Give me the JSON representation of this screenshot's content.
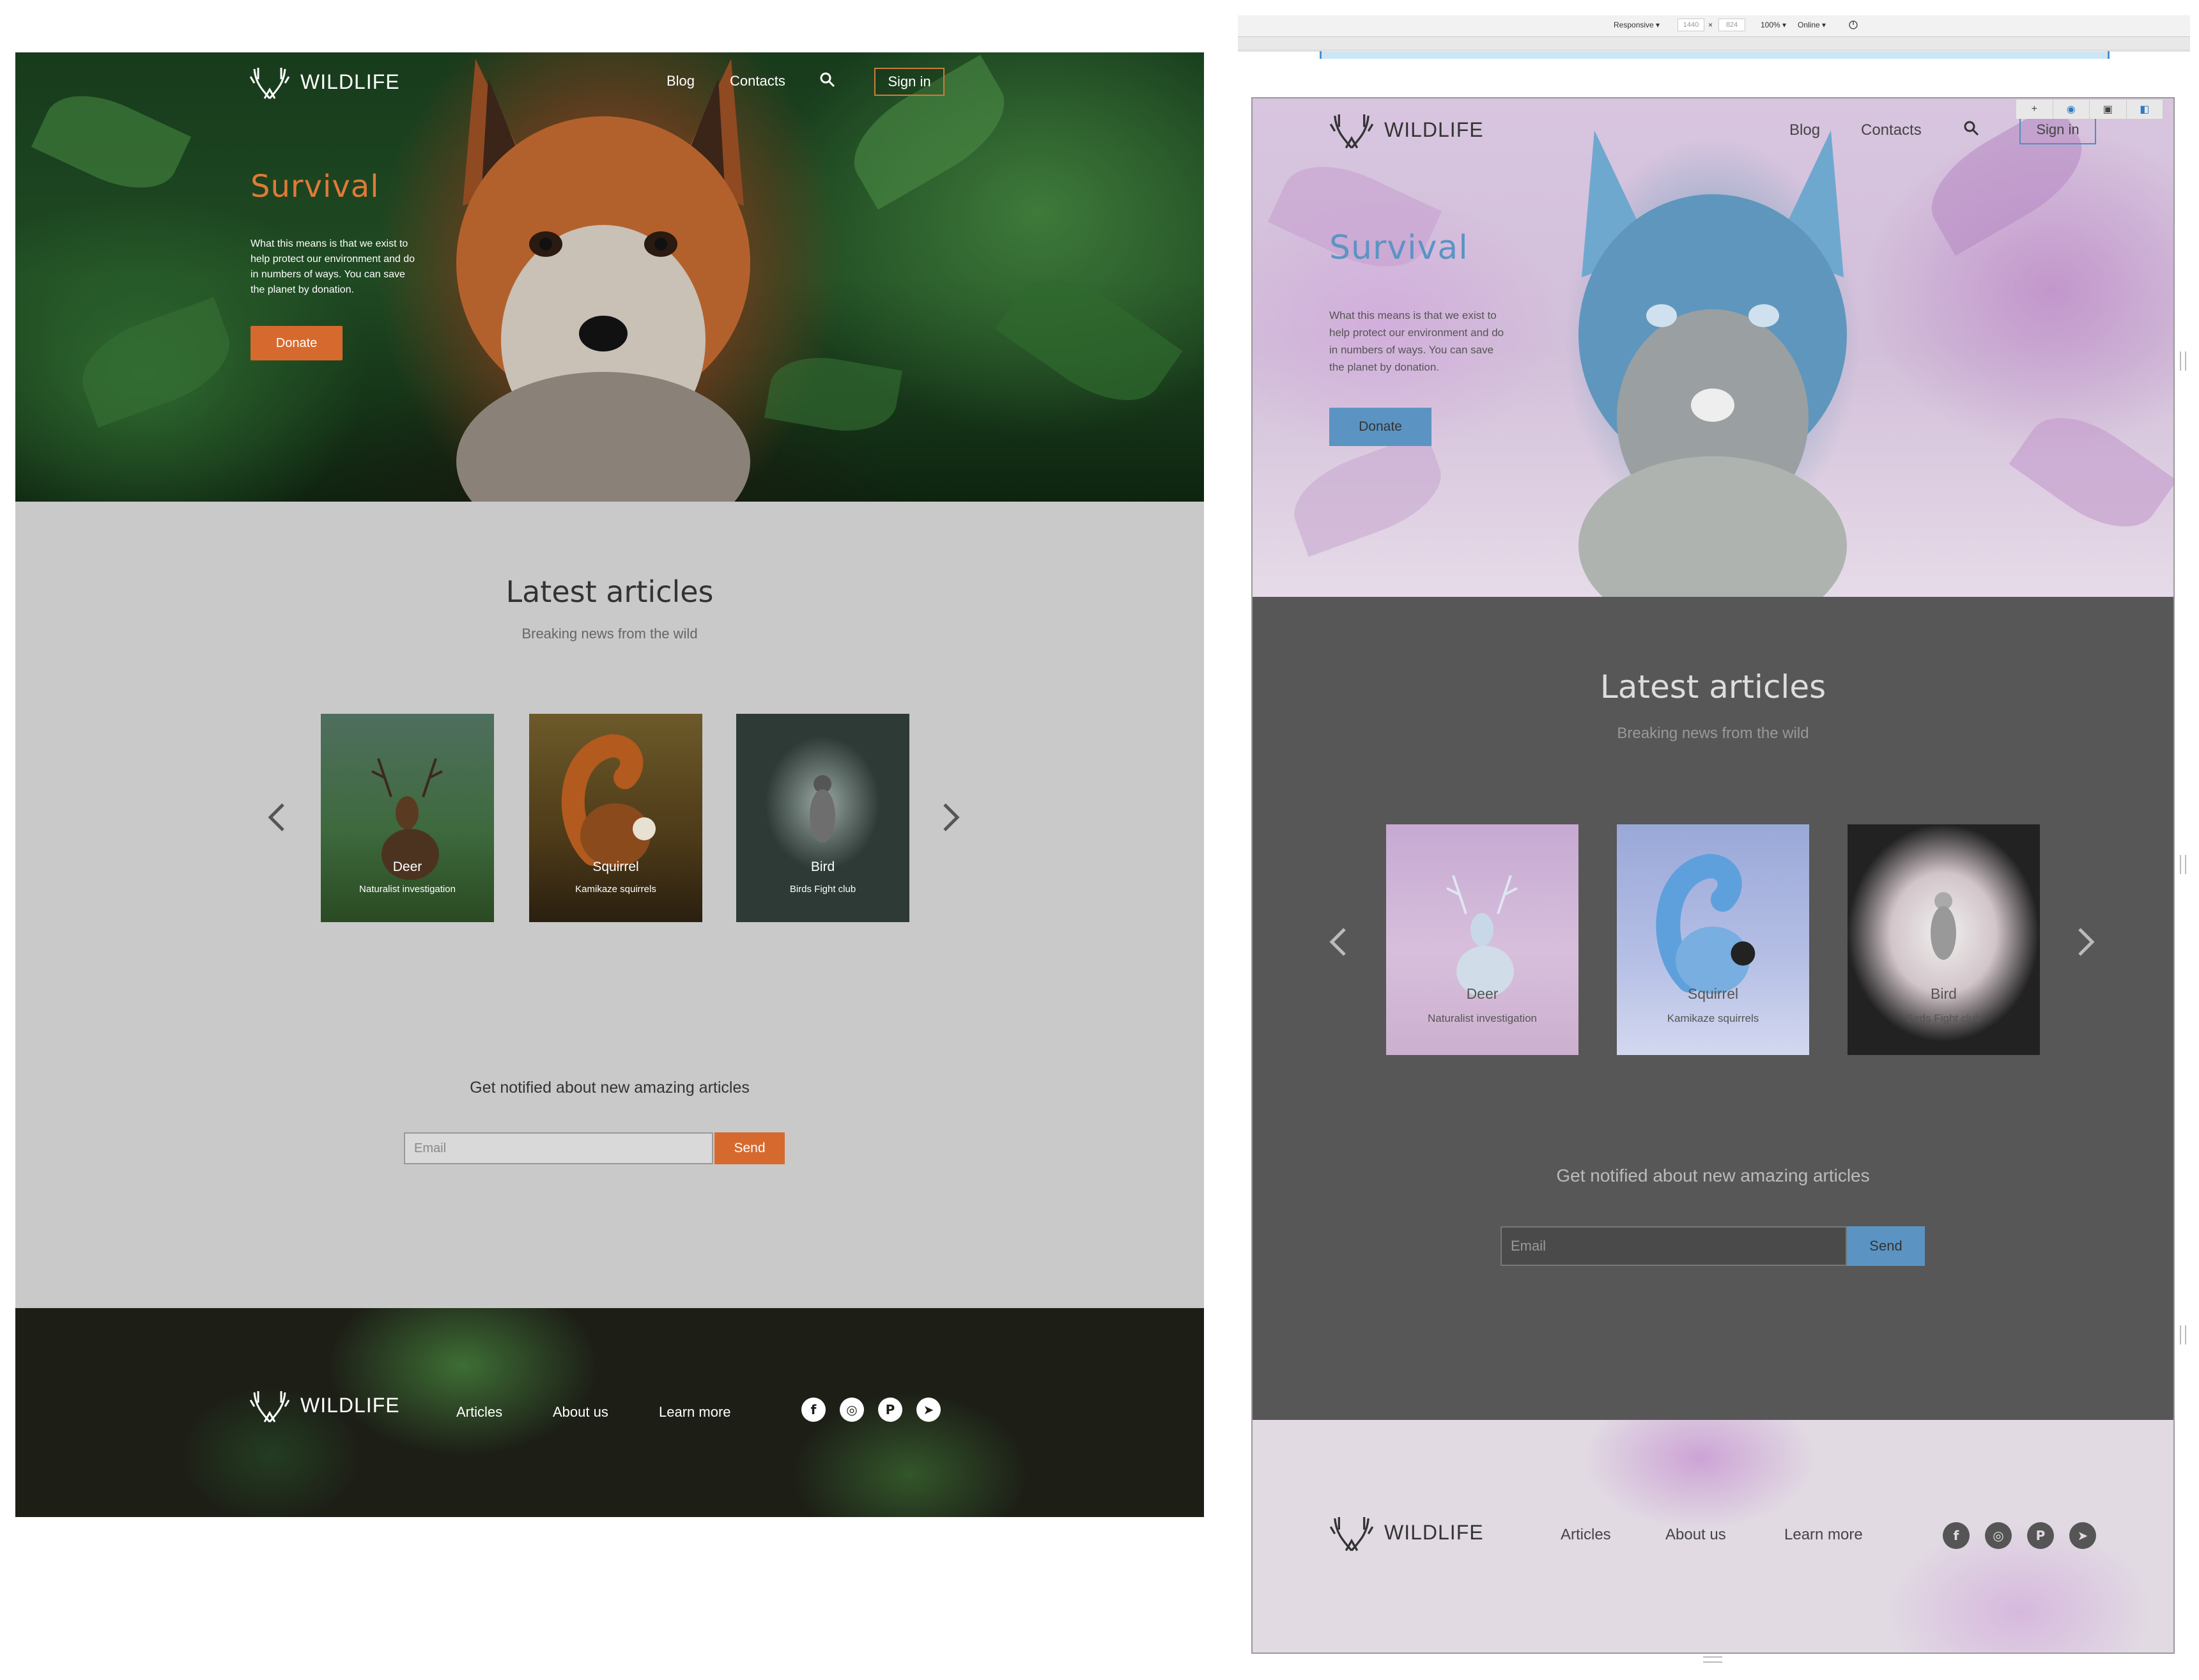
{
  "brand": {
    "name": "WILDLIFE"
  },
  "nav": {
    "blog": "Blog",
    "contacts": "Contacts",
    "signin": "Sign in"
  },
  "hero": {
    "title": "Survival",
    "text": "What this means is that we exist to help protect our environment and do in numbers of ways. You can save the planet by donation.",
    "donate": "Donate"
  },
  "articles": {
    "heading": "Latest articles",
    "subheading": "Breaking news from the wild",
    "cards": [
      {
        "title": "Deer",
        "subtitle": "Naturalist investigation"
      },
      {
        "title": "Squirrel",
        "subtitle": "Kamikaze squirrels"
      },
      {
        "title": "Bird",
        "subtitle": "Birds Fight club"
      }
    ]
  },
  "newsletter": {
    "heading": "Get notified about new amazing articles",
    "email_placeholder": "Email",
    "send": "Send"
  },
  "footer": {
    "articles": "Articles",
    "about": "About us",
    "learn": "Learn more"
  },
  "devtools": {
    "device": "Responsive ▾",
    "width": "1440",
    "times": "×",
    "height": "824",
    "zoom": "100% ▾",
    "throttle": "Online ▾"
  },
  "colors": {
    "accent": "#d66a2e",
    "accent_inverted": "#5b94c3",
    "content_bg": "#c9c9c9",
    "content_bg_inverted": "#575757",
    "footer_bg": "#1d1f17"
  },
  "icons": [
    "antlers-logo-icon",
    "search-icon",
    "chevron-left-icon",
    "chevron-right-icon",
    "facebook-icon",
    "instagram-icon",
    "pinterest-icon",
    "telegram-icon",
    "rotate-icon",
    "eye-icon",
    "lock-icon",
    "dock-icon"
  ]
}
